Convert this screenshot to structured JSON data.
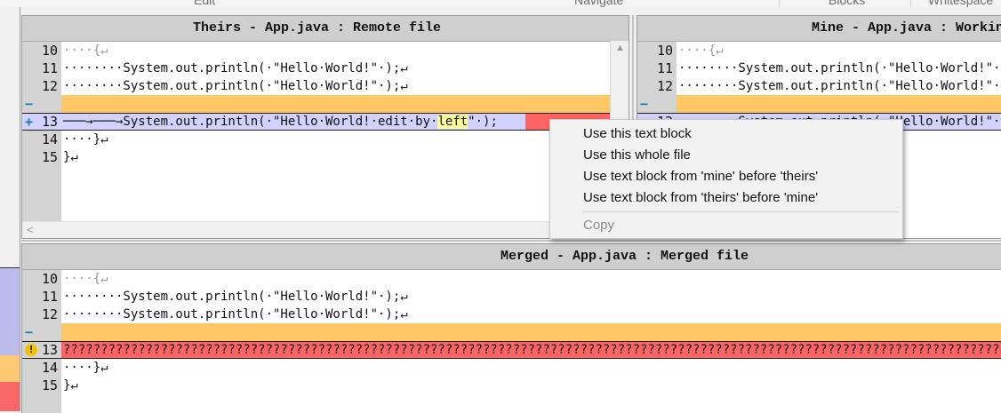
{
  "ribbon": {
    "groups": [
      "Edit",
      "Navigate",
      "Blocks",
      "Whitespace"
    ]
  },
  "theirs": {
    "title": "Theirs - App.java : Remote file",
    "lines": [
      {
        "num": "10",
        "text": "····{↵"
      },
      {
        "num": "11",
        "text": "········System.out.println(·\"Hello·World!\"·);↵"
      },
      {
        "num": "12",
        "text": "········System.out.println(·\"Hello·World!\"·);↵"
      },
      {
        "num": "",
        "marker": "−",
        "text": ""
      },
      {
        "num": "13",
        "marker": "+",
        "pre": "───→───→System.out.println(·\"Hello·World!·edit·by·",
        "highlight": "left",
        "post": "\"·);"
      },
      {
        "num": "14",
        "text": "····}↵"
      },
      {
        "num": "15",
        "text": "}↵"
      }
    ]
  },
  "mine": {
    "title": "Mine - App.java : Working copy",
    "lines": [
      {
        "num": "10",
        "text": "····{↵"
      },
      {
        "num": "11",
        "text": "········System.out.println(·\"Hello·World!\"·);↵"
      },
      {
        "num": "12",
        "text": "········System.out.println(·\"Hello·World!\"·);↵"
      },
      {
        "num": "",
        "marker": "−",
        "text": ""
      },
      {
        "num": "13",
        "text": "───→───→System.out.println(·\"Hello·World!\"·);"
      }
    ]
  },
  "merged": {
    "title": "Merged - App.java : Merged file",
    "lines": [
      {
        "num": "10",
        "text": "····{↵"
      },
      {
        "num": "11",
        "text": "········System.out.println(·\"Hello·World!\"·);↵"
      },
      {
        "num": "12",
        "text": "········System.out.println(·\"Hello·World!\"·);↵"
      },
      {
        "num": "",
        "marker": "−",
        "text": ""
      },
      {
        "num": "13",
        "marker": "!",
        "text": "????????????????????????????????????????????????????????????????????????????????????????????????????????????????????????????????????????"
      },
      {
        "num": "14",
        "text": "····}↵"
      },
      {
        "num": "15",
        "text": "}↵"
      }
    ]
  },
  "context_menu": {
    "items": [
      {
        "label": "Use this text block",
        "enabled": true
      },
      {
        "label": "Use this whole file",
        "enabled": true
      },
      {
        "label": "Use text block from 'mine' before 'theirs'",
        "enabled": true
      },
      {
        "label": "Use text block from 'theirs' before 'mine'",
        "enabled": true
      },
      {
        "label": "Copy",
        "enabled": false
      }
    ]
  },
  "colors": {
    "removed": "#ffc864",
    "conflict": "#ff6464",
    "edited": "#d2d2ff",
    "strip_blue": "#bcbcec",
    "strip_orange": "#ffc873",
    "strip_red": "#f86868"
  },
  "icons": {
    "scroll_up": "triangle-up",
    "scroll_left": "chevron-left",
    "warning": "exclamation-circle"
  }
}
